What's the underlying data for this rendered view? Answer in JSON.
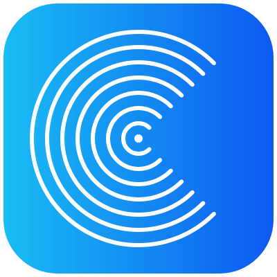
{
  "app_icon": {
    "icon_name": "concentric-c-signal-icon",
    "colors": {
      "gradient_start": "#19BDF3",
      "gradient_end": "#0D5AF2",
      "stroke": "#FFFFFF",
      "background": "#FFFFFF"
    }
  }
}
